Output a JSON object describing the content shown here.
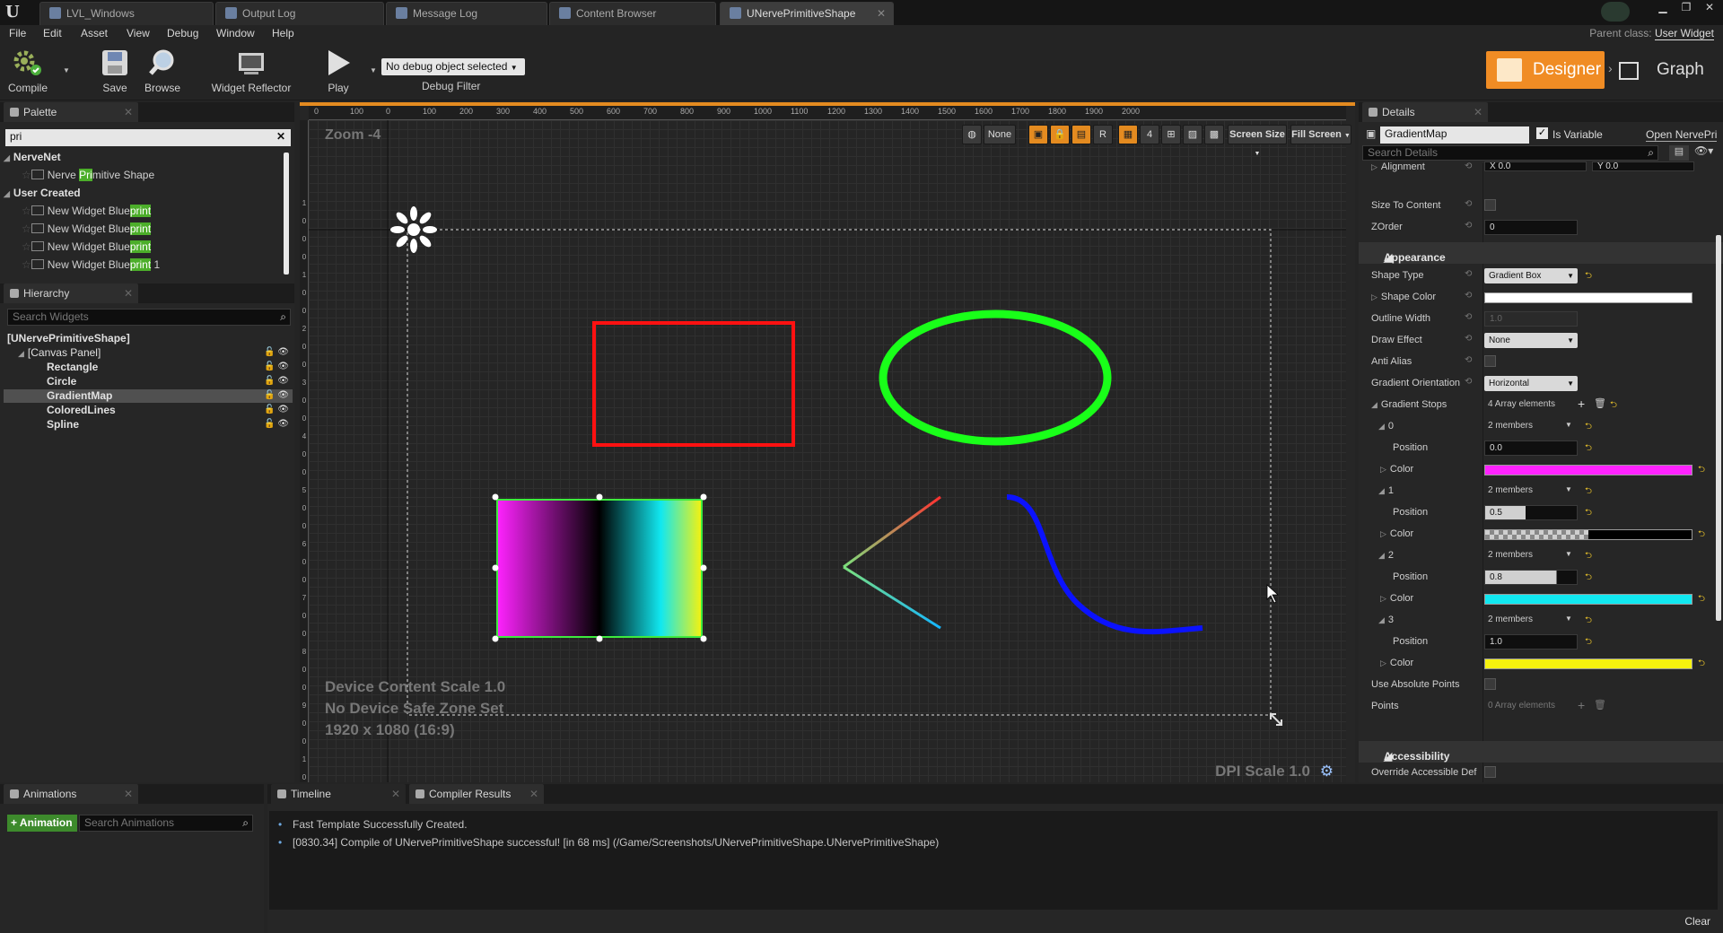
{
  "tabs": [
    "LVL_Windows",
    "Output Log",
    "Message Log",
    "Content Browser",
    "UNervePrimitiveShape"
  ],
  "menu": [
    "File",
    "Edit",
    "Asset",
    "View",
    "Debug",
    "Window",
    "Help"
  ],
  "parent_class": {
    "label": "Parent class:",
    "value": "User Widget"
  },
  "toolbar": {
    "compile": "Compile",
    "save": "Save",
    "browse": "Browse",
    "widget_reflector": "Widget Reflector",
    "play": "Play",
    "debug_select": "No debug object selected",
    "debug_filter": "Debug Filter",
    "designer": "Designer",
    "graph": "Graph"
  },
  "palette": {
    "title": "Palette",
    "search": "pri",
    "categories": [
      {
        "name": "NerveNet",
        "items": [
          {
            "pre": "Nerve ",
            "hl": "Pri",
            "post": "mitive Shape"
          }
        ]
      },
      {
        "name": "User Created",
        "items": [
          {
            "pre": "New Widget Blue",
            "hl": "print",
            "post": ""
          },
          {
            "pre": "New Widget Blue",
            "hl": "print",
            "post": ""
          },
          {
            "pre": "New Widget Blue",
            "hl": "print",
            "post": ""
          },
          {
            "pre": "New Widget Blue",
            "hl": "print",
            "post": " 1"
          }
        ]
      }
    ]
  },
  "hierarchy": {
    "title": "Hierarchy",
    "search_placeholder": "Search Widgets",
    "root": "[UNervePrimitiveShape]",
    "canvas": "[Canvas Panel]",
    "items": [
      "Rectangle",
      "Circle",
      "GradientMap",
      "ColoredLines",
      "Spline"
    ],
    "selected": "GradientMap"
  },
  "viewport": {
    "zoom": "Zoom -4",
    "device_scale": "Device Content Scale 1.0",
    "safe_zone": "No Device Safe Zone Set",
    "resolution": "1920 x 1080 (16:9)",
    "dpi": "DPI Scale 1.0",
    "tools": {
      "none": "None",
      "r": "R",
      "four": "4",
      "screen_size": "Screen Size",
      "fill_screen": "Fill Screen"
    },
    "ruler_top": [
      "0",
      "100",
      "0",
      "100",
      "200",
      "300",
      "400",
      "500",
      "600",
      "700",
      "800",
      "900",
      "1000",
      "1100",
      "1200",
      "1300",
      "1400",
      "1500",
      "1600",
      "1700",
      "1800",
      "1900",
      "2000"
    ],
    "ruler_left": [
      "1",
      "0",
      "0",
      "0",
      "1",
      "0",
      "0",
      "2",
      "0",
      "0",
      "3",
      "0",
      "0",
      "4",
      "0",
      "0",
      "5",
      "0",
      "0",
      "6",
      "0",
      "0",
      "7",
      "0",
      "0",
      "8",
      "0",
      "0",
      "9",
      "0",
      "0",
      "1",
      "0",
      "0",
      "0"
    ],
    "colors": {
      "rect": "#ff1111",
      "ellipse": "#19ff19",
      "spline": "#0b12ff"
    }
  },
  "details": {
    "title": "Details",
    "widget_name": "GradientMap",
    "is_variable": "Is Variable",
    "open_link": "Open NervePri",
    "search_placeholder": "Search Details",
    "rows": {
      "alignment": "Alignment",
      "align_x": "X 0.0",
      "align_y": "Y 0.0",
      "size_to_content": "Size To Content",
      "zorder": "ZOrder",
      "zorder_val": "0",
      "appearance": "Appearance",
      "shape_type": "Shape Type",
      "shape_type_val": "Gradient Box",
      "shape_color": "Shape Color",
      "outline_width": "Outline Width",
      "outline_width_val": "1.0",
      "draw_effect": "Draw Effect",
      "draw_effect_val": "None",
      "anti_alias": "Anti Alias",
      "gradient_orientation": "Gradient Orientation",
      "gradient_orientation_val": "Horizontal",
      "gradient_stops": "Gradient Stops",
      "gradient_stops_val": "4 Array elements",
      "use_absolute_points": "Use Absolute Points",
      "points": "Points",
      "points_val": "0 Array elements",
      "accessibility": "Accessibility",
      "override_accessible": "Override Accessible Def"
    },
    "stops": [
      {
        "index": "0",
        "members": "2 members",
        "position": "0.0",
        "color": "#ff22ff",
        "transparent": false
      },
      {
        "index": "1",
        "members": "2 members",
        "position": "0.5",
        "color": "#000000",
        "transparent": true
      },
      {
        "index": "2",
        "members": "2 members",
        "position": "0.8",
        "color": "#11e8f0",
        "transparent": false
      },
      {
        "index": "3",
        "members": "2 members",
        "position": "1.0",
        "color": "#f6f20e",
        "transparent": false
      }
    ],
    "position_label": "Position",
    "color_label": "Color"
  },
  "animations": {
    "title": "Animations",
    "add": "+ Animation",
    "search_placeholder": "Search Animations"
  },
  "bottom_tabs": {
    "timeline": "Timeline",
    "compiler": "Compiler Results"
  },
  "log": [
    "Fast Template Successfully Created.",
    "[0830.34] Compile of UNervePrimitiveShape successful! [in 68 ms] (/Game/Screenshots/UNervePrimitiveShape.UNervePrimitiveShape)"
  ],
  "clear": "Clear"
}
